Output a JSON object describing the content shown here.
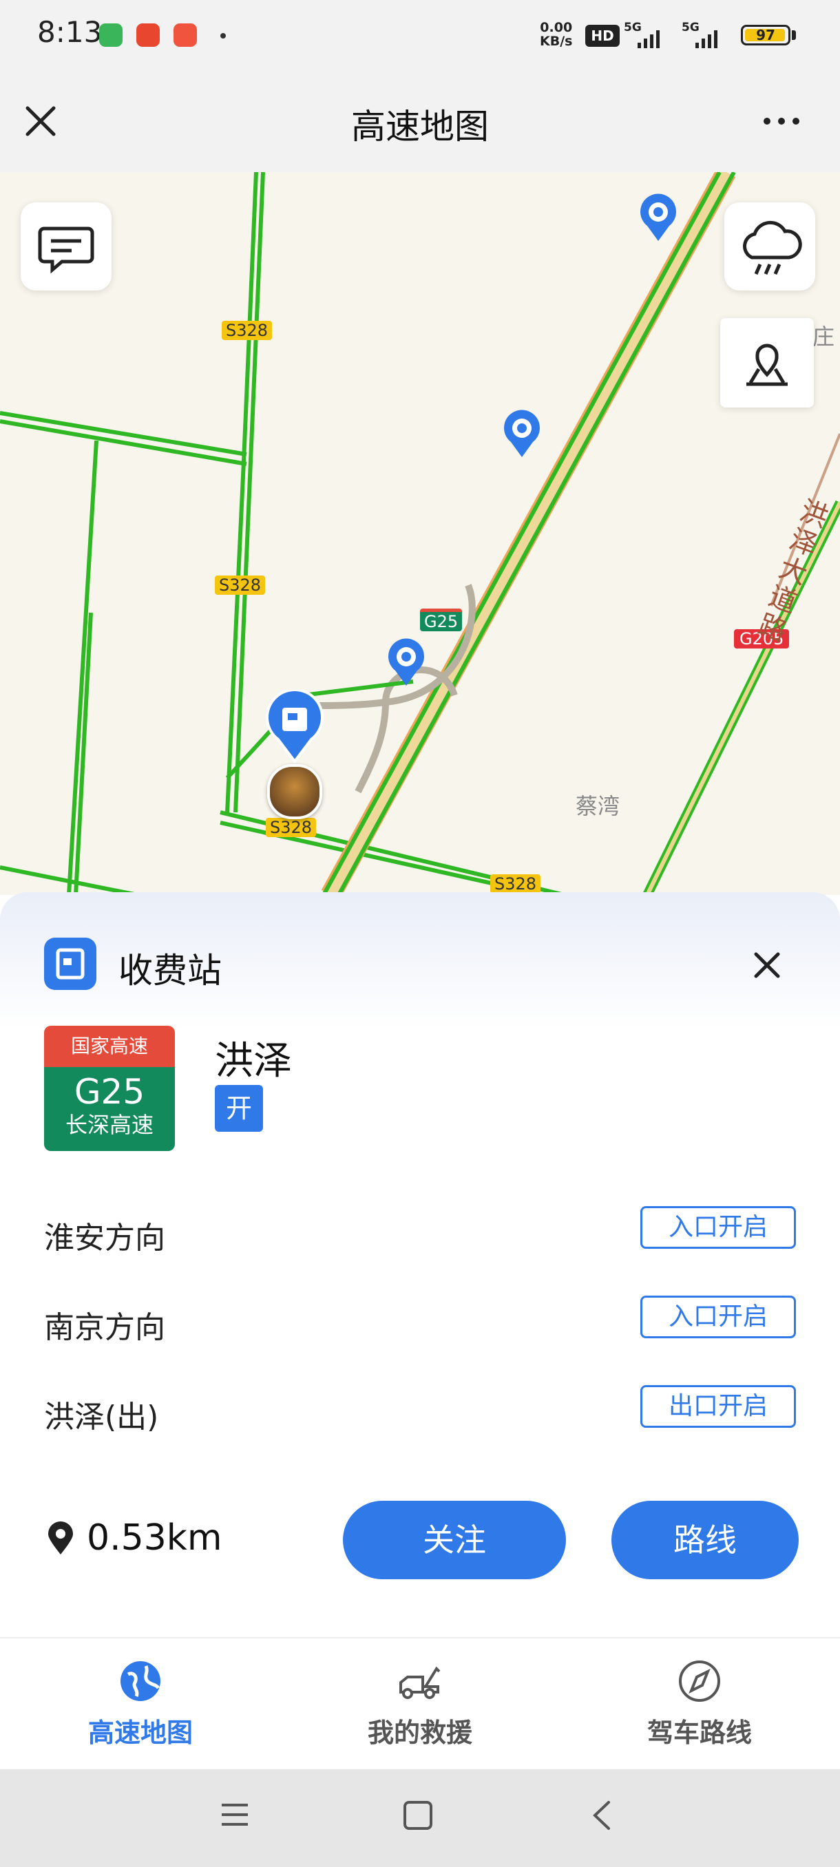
{
  "status_bar": {
    "time": "8:13",
    "net_speed_value": "0.00",
    "net_speed_unit": "KB/s",
    "hd_label": "HD",
    "signal1_label": "5G",
    "signal2_label": "5G",
    "battery_level": "97",
    "app_icons": [
      "wechat-icon",
      "red-packet-icon",
      "notification-app-icon"
    ]
  },
  "header": {
    "title": "高速地图",
    "close_icon": "close-icon",
    "more_icon": "more-icon"
  },
  "map": {
    "road_labels": [
      "S328",
      "S328",
      "S328",
      "S328",
      "G25",
      "G205"
    ],
    "place_labels": [
      "蔡湾",
      "庄"
    ],
    "road_name_vertical": "洪泽大道路",
    "buttons": [
      "message-icon",
      "weather-icon",
      "location-pin-icon"
    ]
  },
  "sheet": {
    "title": "收费站",
    "highway": {
      "level": "国家高速",
      "code": "G25",
      "name": "长深高速"
    },
    "station_name": "洪泽",
    "status_tag": "开",
    "directions": [
      {
        "label": "淮安方向",
        "status": "入口开启"
      },
      {
        "label": "南京方向",
        "status": "入口开启"
      },
      {
        "label": "洪泽(出)",
        "status": "出口开启"
      }
    ],
    "distance": "0.53km",
    "follow_label": "关注",
    "route_label": "路线"
  },
  "bottom_nav": {
    "items": [
      {
        "label": "高速地图",
        "icon": "globe-icon",
        "active": true
      },
      {
        "label": "我的救援",
        "icon": "tow-truck-icon",
        "active": false
      },
      {
        "label": "驾车路线",
        "icon": "compass-icon",
        "active": false
      }
    ]
  },
  "colors": {
    "accent": "#2f79e8",
    "road_green": "#2fb824",
    "highway_red": "#e54b3a",
    "highway_green": "#138a5c",
    "provincial_yellow": "#f5c40f"
  }
}
